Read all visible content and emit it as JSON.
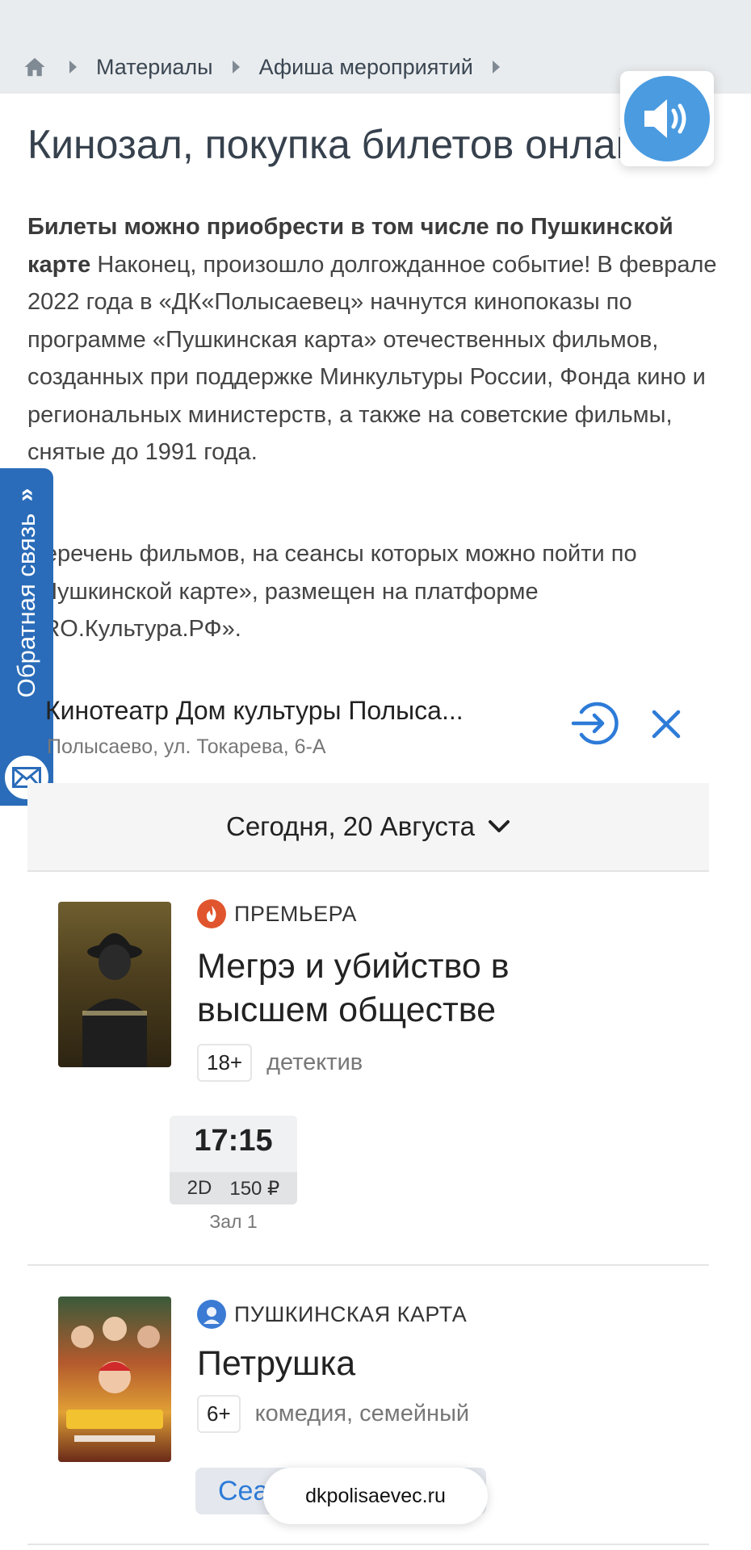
{
  "breadcrumb": {
    "items": [
      "Материалы",
      "Афиша мероприятий"
    ]
  },
  "page": {
    "title": "Кинозал, покупка билетов онлайн",
    "intro_bold": "Билеты можно приобрести в том числе по Пушкинской карте",
    "intro_text": " Наконец, произошло долгожданное событие! В феврале 2022 года в «ДК«Полысаевец» начнутся кинопоказы по программе «Пушкинская карта» отечественных фильмов, созданных при поддержке Минкультуры России, Фонда кино и региональных министерств, а также на советские фильмы, снятые до 1991 года.",
    "paragraph2": "Перечень фильмов, на сеансы которых можно пойти по «Пушкинской карте», размещен на платформе PRO.Культура.РФ»."
  },
  "feedback": {
    "label": "Обратная связь"
  },
  "widget": {
    "cinema_name": "Кинотеатр Дом культуры Полыса...",
    "cinema_address": "Полысаево, ул. Токарева, 6-А",
    "date_label": "Сегодня, 20 Августа"
  },
  "movies": [
    {
      "tag": "ПРЕМЬЕРА",
      "title": "Мегрэ и убийство в высшем обществе",
      "age": "18+",
      "genre": "детектив",
      "session": {
        "time": "17:15",
        "format": "2D",
        "price": "150 ₽",
        "hall": "Зал 1"
      }
    },
    {
      "tag": "ПУШКИНСКАЯ КАРТА",
      "title": "Петрушка",
      "age": "6+",
      "genre": "комедия, семейный",
      "button": "Сеансы"
    }
  ],
  "browser": {
    "url": "dkpolisaevec.ru"
  },
  "colors": {
    "accent": "#2d7bd8",
    "feedback_tab": "#2a6cb9",
    "premiere_badge": "#e0552d",
    "sound_button": "#4a9be0"
  }
}
